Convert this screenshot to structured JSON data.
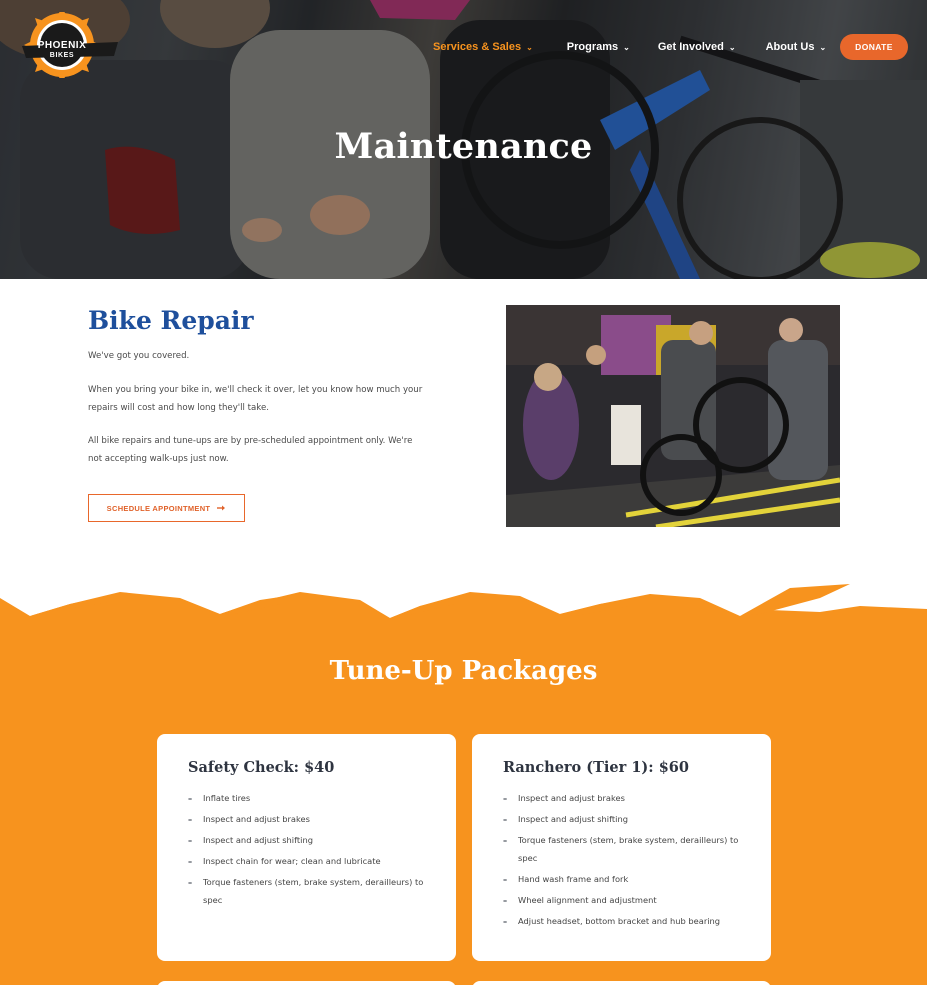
{
  "header": {
    "logo": {
      "line1": "PHOENIX",
      "line2": "BIKES"
    },
    "nav": [
      {
        "label": "Services & Sales",
        "active": true
      },
      {
        "label": "Programs",
        "active": false
      },
      {
        "label": "Get Involved",
        "active": false
      },
      {
        "label": "About Us",
        "active": false
      }
    ],
    "donate_label": "DONATE"
  },
  "hero": {
    "title": "Maintenance"
  },
  "repair": {
    "title": "Bike Repair",
    "paragraphs": [
      "We've got you covered.",
      "When you bring your bike in, we'll check it over, let you know how much your repairs will cost and how long they'll take.",
      "All bike repairs and tune-ups are by pre-scheduled appointment only. We're not accepting walk-ups just now."
    ],
    "button_label": "SCHEDULE APPOINTMENT",
    "button_icon": "arrow-right-icon"
  },
  "packages": {
    "title": "Tune-Up Packages",
    "cards": [
      {
        "title": "Safety Check: $40",
        "items": [
          "Inflate tires",
          "Inspect and adjust brakes",
          "Inspect and adjust shifting",
          "Inspect chain for wear; clean and lubricate",
          "Torque fasteners (stem, brake system, derailleurs) to spec"
        ]
      },
      {
        "title": "Ranchero (Tier 1): $60",
        "items": [
          "Inspect and adjust brakes",
          "Inspect and adjust shifting",
          "Torque fasteners (stem, brake system, derailleurs) to spec",
          "Hand wash frame and fork",
          "Wheel alignment and adjustment",
          "Adjust headset, bottom bracket and hub bearing"
        ]
      }
    ]
  },
  "colors": {
    "brand_blue": "#1e4f9c",
    "brand_orange": "#f7931e",
    "accent_orange": "#e8672b"
  }
}
